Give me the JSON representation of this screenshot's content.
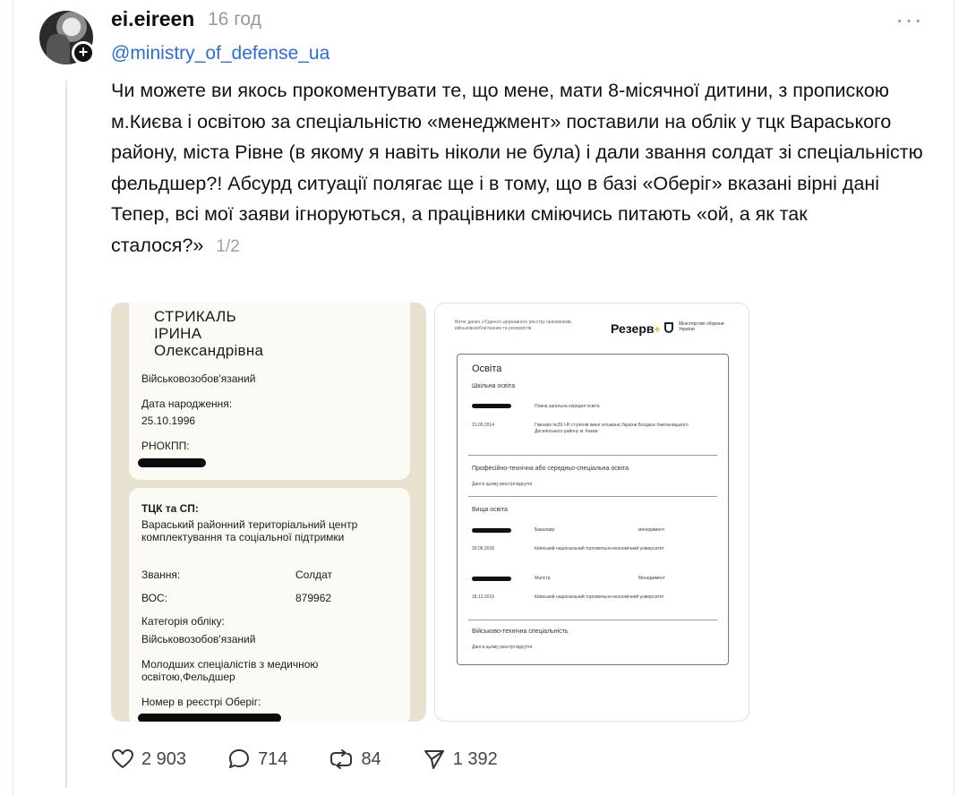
{
  "post": {
    "username": "ei.eireen",
    "time_ago": "16 год",
    "more_label": "···",
    "mention": "@ministry_of_defense_ua",
    "paragraphs": [
      "Чи можете ви якось прокоментувати те, що мене, мати 8-місячної дитини, з пропискою м.Києва і освітою за спеціальністю «менеджмент» поставили на облік у тцк Вараського району, міста Рівне (в якому я навіть ніколи не була) і дали звання солдат зі спеціальністю фельдшер?! Абсурд ситуації полягає ще і в тому, що в базі «Оберіг» вказані вірні дані",
      "Тепер, всі мої заяви ігноруються, а працівники сміючись питають «ой, а як так сталося?»"
    ],
    "pager": "1/2",
    "avatar_plus": "+"
  },
  "left_image": {
    "surname": "СТРИКАЛЬ",
    "first_name": "ІРИНА",
    "patronymic": "Олександрівна",
    "status": "Військовозобов'язаний",
    "dob_label": "Дата народження:",
    "dob_value": "25.10.1996",
    "rnokpp_label": "РНОКПП:",
    "tck_label": "ТЦК та СП:",
    "tck_value": "Вараський районний територіальний центр комплектування та соціальної підтримки",
    "rank_label": "Звання:",
    "rank_value": "Солдат",
    "vos_label": "ВОС:",
    "vos_value": "879962",
    "category_label": "Категорія обліку:",
    "category_value": "Військовозобов'язаний",
    "specialty_value": "Молодших спеціалістів з медичною освітою,Фельдшер",
    "registry_label": "Номер в реєстрі Оберіг:"
  },
  "right_image": {
    "header_text": "Витяг даних з Єдиного державного реєстру призовників, військовозобов'язаних та резервістів",
    "brand": "Резерв",
    "brand_plus": "+",
    "ministry": "Міністерство оборони України",
    "section_title": "Освіта",
    "school_label": "Шкільна освіта",
    "school_level": "Повна загальна середня освіта",
    "school_date": "31.05.2014",
    "school_name": "Гімназія №39 І-ІІІ ступенів імені гетьмана України Богдана Хмельницького Деснянського району м. Києва",
    "vocational_label": "Професійно-технічна або середньо-спеціальна освіта",
    "no_data": "Дані в цьому реєстрі відсутні",
    "higher_label": "Вища освіта",
    "bachelor": "Бакалавр",
    "management": "менеджмент",
    "uni_date_1": "30.06.2018",
    "university": "Київський національний торговельно-економічний університет",
    "master": "Магістр",
    "management_2": "Менеджмент",
    "uni_date_2": "18.12.2019",
    "military_label": "Військово-технічна спеціальність",
    "no_data_2": "Дані в цьому реєстрі відсутні"
  },
  "actions": {
    "likes": "2 903",
    "replies": "714",
    "reposts": "84",
    "shares": "1 392"
  }
}
